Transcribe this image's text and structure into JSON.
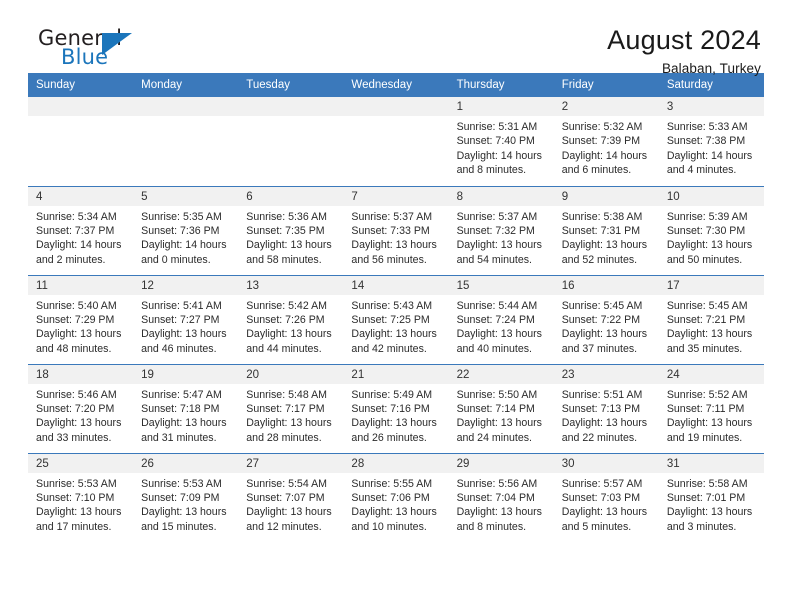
{
  "brand": {
    "name_top": "General",
    "name_bottom": "Blue",
    "flag_icon": "triangle-flag-icon",
    "accent_color": "#1b75bb"
  },
  "header": {
    "title": "August 2024",
    "subtitle": "Balaban, Turkey"
  },
  "theme": {
    "header_row_bg": "#3b79bb",
    "daynum_band_bg": "#f1f1f1",
    "grid_line": "#3b79bb",
    "text": "#2b2b2b"
  },
  "weekday_headers": [
    "Sunday",
    "Monday",
    "Tuesday",
    "Wednesday",
    "Thursday",
    "Friday",
    "Saturday"
  ],
  "weeks": [
    [
      {
        "day": "",
        "empty": true
      },
      {
        "day": "",
        "empty": true
      },
      {
        "day": "",
        "empty": true
      },
      {
        "day": "",
        "empty": true
      },
      {
        "day": "1",
        "sunrise": "Sunrise: 5:31 AM",
        "sunset": "Sunset: 7:40 PM",
        "daylight1": "Daylight: 14 hours",
        "daylight2": "and 8 minutes."
      },
      {
        "day": "2",
        "sunrise": "Sunrise: 5:32 AM",
        "sunset": "Sunset: 7:39 PM",
        "daylight1": "Daylight: 14 hours",
        "daylight2": "and 6 minutes."
      },
      {
        "day": "3",
        "sunrise": "Sunrise: 5:33 AM",
        "sunset": "Sunset: 7:38 PM",
        "daylight1": "Daylight: 14 hours",
        "daylight2": "and 4 minutes."
      }
    ],
    [
      {
        "day": "4",
        "sunrise": "Sunrise: 5:34 AM",
        "sunset": "Sunset: 7:37 PM",
        "daylight1": "Daylight: 14 hours",
        "daylight2": "and 2 minutes."
      },
      {
        "day": "5",
        "sunrise": "Sunrise: 5:35 AM",
        "sunset": "Sunset: 7:36 PM",
        "daylight1": "Daylight: 14 hours",
        "daylight2": "and 0 minutes."
      },
      {
        "day": "6",
        "sunrise": "Sunrise: 5:36 AM",
        "sunset": "Sunset: 7:35 PM",
        "daylight1": "Daylight: 13 hours",
        "daylight2": "and 58 minutes."
      },
      {
        "day": "7",
        "sunrise": "Sunrise: 5:37 AM",
        "sunset": "Sunset: 7:33 PM",
        "daylight1": "Daylight: 13 hours",
        "daylight2": "and 56 minutes."
      },
      {
        "day": "8",
        "sunrise": "Sunrise: 5:37 AM",
        "sunset": "Sunset: 7:32 PM",
        "daylight1": "Daylight: 13 hours",
        "daylight2": "and 54 minutes."
      },
      {
        "day": "9",
        "sunrise": "Sunrise: 5:38 AM",
        "sunset": "Sunset: 7:31 PM",
        "daylight1": "Daylight: 13 hours",
        "daylight2": "and 52 minutes."
      },
      {
        "day": "10",
        "sunrise": "Sunrise: 5:39 AM",
        "sunset": "Sunset: 7:30 PM",
        "daylight1": "Daylight: 13 hours",
        "daylight2": "and 50 minutes."
      }
    ],
    [
      {
        "day": "11",
        "sunrise": "Sunrise: 5:40 AM",
        "sunset": "Sunset: 7:29 PM",
        "daylight1": "Daylight: 13 hours",
        "daylight2": "and 48 minutes."
      },
      {
        "day": "12",
        "sunrise": "Sunrise: 5:41 AM",
        "sunset": "Sunset: 7:27 PM",
        "daylight1": "Daylight: 13 hours",
        "daylight2": "and 46 minutes."
      },
      {
        "day": "13",
        "sunrise": "Sunrise: 5:42 AM",
        "sunset": "Sunset: 7:26 PM",
        "daylight1": "Daylight: 13 hours",
        "daylight2": "and 44 minutes."
      },
      {
        "day": "14",
        "sunrise": "Sunrise: 5:43 AM",
        "sunset": "Sunset: 7:25 PM",
        "daylight1": "Daylight: 13 hours",
        "daylight2": "and 42 minutes."
      },
      {
        "day": "15",
        "sunrise": "Sunrise: 5:44 AM",
        "sunset": "Sunset: 7:24 PM",
        "daylight1": "Daylight: 13 hours",
        "daylight2": "and 40 minutes."
      },
      {
        "day": "16",
        "sunrise": "Sunrise: 5:45 AM",
        "sunset": "Sunset: 7:22 PM",
        "daylight1": "Daylight: 13 hours",
        "daylight2": "and 37 minutes."
      },
      {
        "day": "17",
        "sunrise": "Sunrise: 5:45 AM",
        "sunset": "Sunset: 7:21 PM",
        "daylight1": "Daylight: 13 hours",
        "daylight2": "and 35 minutes."
      }
    ],
    [
      {
        "day": "18",
        "sunrise": "Sunrise: 5:46 AM",
        "sunset": "Sunset: 7:20 PM",
        "daylight1": "Daylight: 13 hours",
        "daylight2": "and 33 minutes."
      },
      {
        "day": "19",
        "sunrise": "Sunrise: 5:47 AM",
        "sunset": "Sunset: 7:18 PM",
        "daylight1": "Daylight: 13 hours",
        "daylight2": "and 31 minutes."
      },
      {
        "day": "20",
        "sunrise": "Sunrise: 5:48 AM",
        "sunset": "Sunset: 7:17 PM",
        "daylight1": "Daylight: 13 hours",
        "daylight2": "and 28 minutes."
      },
      {
        "day": "21",
        "sunrise": "Sunrise: 5:49 AM",
        "sunset": "Sunset: 7:16 PM",
        "daylight1": "Daylight: 13 hours",
        "daylight2": "and 26 minutes."
      },
      {
        "day": "22",
        "sunrise": "Sunrise: 5:50 AM",
        "sunset": "Sunset: 7:14 PM",
        "daylight1": "Daylight: 13 hours",
        "daylight2": "and 24 minutes."
      },
      {
        "day": "23",
        "sunrise": "Sunrise: 5:51 AM",
        "sunset": "Sunset: 7:13 PM",
        "daylight1": "Daylight: 13 hours",
        "daylight2": "and 22 minutes."
      },
      {
        "day": "24",
        "sunrise": "Sunrise: 5:52 AM",
        "sunset": "Sunset: 7:11 PM",
        "daylight1": "Daylight: 13 hours",
        "daylight2": "and 19 minutes."
      }
    ],
    [
      {
        "day": "25",
        "sunrise": "Sunrise: 5:53 AM",
        "sunset": "Sunset: 7:10 PM",
        "daylight1": "Daylight: 13 hours",
        "daylight2": "and 17 minutes."
      },
      {
        "day": "26",
        "sunrise": "Sunrise: 5:53 AM",
        "sunset": "Sunset: 7:09 PM",
        "daylight1": "Daylight: 13 hours",
        "daylight2": "and 15 minutes."
      },
      {
        "day": "27",
        "sunrise": "Sunrise: 5:54 AM",
        "sunset": "Sunset: 7:07 PM",
        "daylight1": "Daylight: 13 hours",
        "daylight2": "and 12 minutes."
      },
      {
        "day": "28",
        "sunrise": "Sunrise: 5:55 AM",
        "sunset": "Sunset: 7:06 PM",
        "daylight1": "Daylight: 13 hours",
        "daylight2": "and 10 minutes."
      },
      {
        "day": "29",
        "sunrise": "Sunrise: 5:56 AM",
        "sunset": "Sunset: 7:04 PM",
        "daylight1": "Daylight: 13 hours",
        "daylight2": "and 8 minutes."
      },
      {
        "day": "30",
        "sunrise": "Sunrise: 5:57 AM",
        "sunset": "Sunset: 7:03 PM",
        "daylight1": "Daylight: 13 hours",
        "daylight2": "and 5 minutes."
      },
      {
        "day": "31",
        "sunrise": "Sunrise: 5:58 AM",
        "sunset": "Sunset: 7:01 PM",
        "daylight1": "Daylight: 13 hours",
        "daylight2": "and 3 minutes."
      }
    ]
  ]
}
